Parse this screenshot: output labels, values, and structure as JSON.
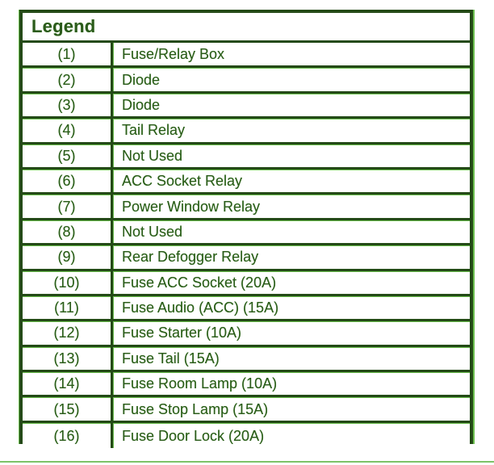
{
  "legend": {
    "title": "Legend",
    "rows": [
      {
        "num": "(1)",
        "desc": "Fuse/Relay Box"
      },
      {
        "num": "(2)",
        "desc": "Diode"
      },
      {
        "num": "(3)",
        "desc": "Diode"
      },
      {
        "num": "(4)",
        "desc": "Tail Relay"
      },
      {
        "num": "(5)",
        "desc": "Not Used"
      },
      {
        "num": "(6)",
        "desc": "ACC Socket Relay"
      },
      {
        "num": "(7)",
        "desc": "Power Window Relay"
      },
      {
        "num": "(8)",
        "desc": "Not Used"
      },
      {
        "num": "(9)",
        "desc": "Rear Defogger Relay"
      },
      {
        "num": "(10)",
        "desc": "Fuse ACC Socket (20A)"
      },
      {
        "num": "(11)",
        "desc": "Fuse Audio (ACC) (15A)"
      },
      {
        "num": "(12)",
        "desc": "Fuse Starter (10A)"
      },
      {
        "num": "(13)",
        "desc": "Fuse Tail (15A)"
      },
      {
        "num": "(14)",
        "desc": "Fuse Room Lamp (10A)"
      },
      {
        "num": "(15)",
        "desc": "Fuse Stop Lamp (15A)"
      },
      {
        "num": "(16)",
        "desc": "Fuse Door Lock (20A)"
      }
    ]
  },
  "colors": {
    "border_dark": "#244a17",
    "border_light": "#6bbf4e",
    "text": "#2b5a1b",
    "bottom_rule": "#7dc267"
  }
}
